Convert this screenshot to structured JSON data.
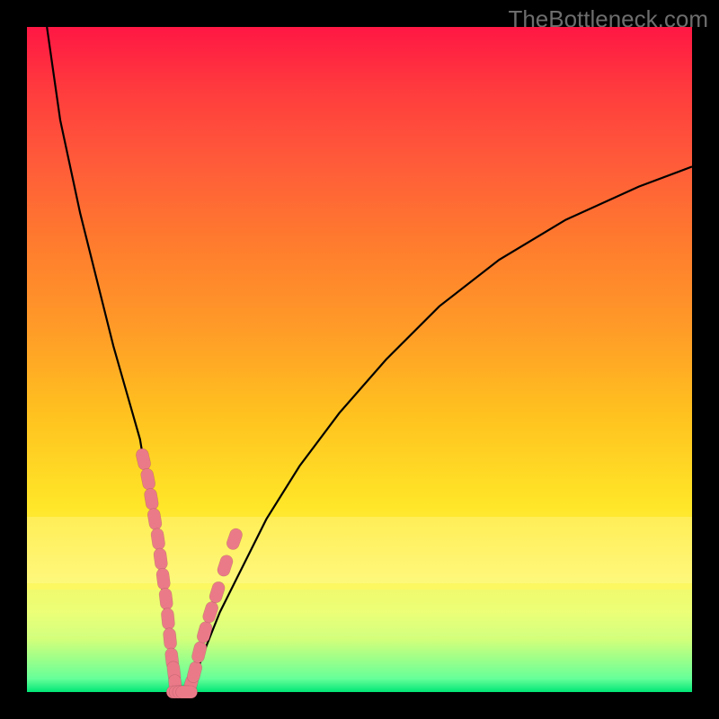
{
  "watermark": "TheBottleneck.com",
  "chart_data": {
    "type": "line",
    "title": "",
    "xlabel": "",
    "ylabel": "",
    "xlim": [
      0,
      100
    ],
    "ylim": [
      0,
      100
    ],
    "grid": false,
    "legend": false,
    "series": [
      {
        "name": "left-curve",
        "x": [
          3,
          5,
          8,
          11,
          13,
          15,
          17,
          18,
          19,
          19.8,
          20.4,
          20.9,
          21.3,
          21.6,
          21.8,
          22.0,
          22.2
        ],
        "y": [
          0,
          14,
          28,
          40,
          48,
          55,
          62,
          68,
          74,
          80,
          85,
          89,
          92,
          95,
          97,
          98.5,
          100
        ]
      },
      {
        "name": "right-curve",
        "x": [
          24.5,
          25.5,
          27,
          29,
          32,
          36,
          41,
          47,
          54,
          62,
          71,
          81,
          92,
          100
        ],
        "y": [
          100,
          97,
          93,
          88,
          82,
          74,
          66,
          58,
          50,
          42,
          35,
          29,
          24,
          21
        ]
      },
      {
        "name": "markers-left",
        "x": [
          17.5,
          18.2,
          18.7,
          19.2,
          19.7,
          20.1,
          20.5,
          20.9,
          21.2,
          21.5,
          21.8,
          22.1,
          22.3
        ],
        "y": [
          65,
          68,
          71,
          74,
          77,
          80,
          83,
          86,
          89,
          92,
          95,
          97,
          99
        ],
        "marker": true
      },
      {
        "name": "markers-right",
        "x": [
          24.6,
          25.2,
          25.9,
          26.7,
          27.6,
          28.6,
          29.8,
          31.2
        ],
        "y": [
          99,
          97,
          94,
          91,
          88,
          85,
          81,
          77
        ],
        "marker": true
      },
      {
        "name": "markers-valley",
        "x": [
          22.6,
          23.0,
          23.5,
          24.0
        ],
        "y": [
          100,
          100,
          100,
          100
        ],
        "marker": true
      }
    ],
    "marker_color": "#eb7a88",
    "curve_color": "#000000",
    "background_gradient": [
      "#ff1744",
      "#ff9a28",
      "#ffe628",
      "#00e676"
    ]
  }
}
